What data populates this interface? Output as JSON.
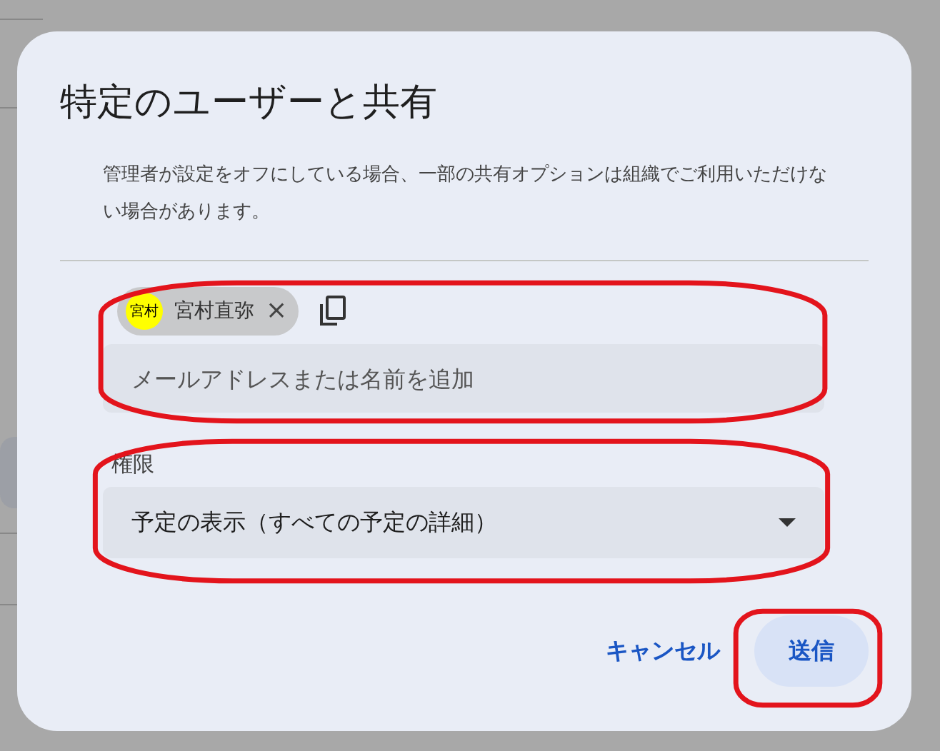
{
  "dialog": {
    "title": "特定のユーザーと共有",
    "notice": "管理者が設定をオフにしている場合、一部の共有オプションは組織でご利用いただけない場合があります。",
    "chips": [
      {
        "avatar": "宮村",
        "name": "宮村直弥",
        "remove": "×"
      }
    ],
    "input": {
      "placeholder": "メールアドレスまたは名前を追加"
    },
    "permission": {
      "label": "権限",
      "value": "予定の表示（すべての予定の詳細）"
    },
    "buttons": [
      {
        "label": "キャンセル",
        "kind": "text"
      },
      {
        "label": "送信",
        "kind": "tonal"
      }
    ]
  },
  "annotations": [
    {
      "kind": "outline"
    },
    {
      "kind": "outline"
    },
    {
      "kind": "outline"
    }
  ]
}
